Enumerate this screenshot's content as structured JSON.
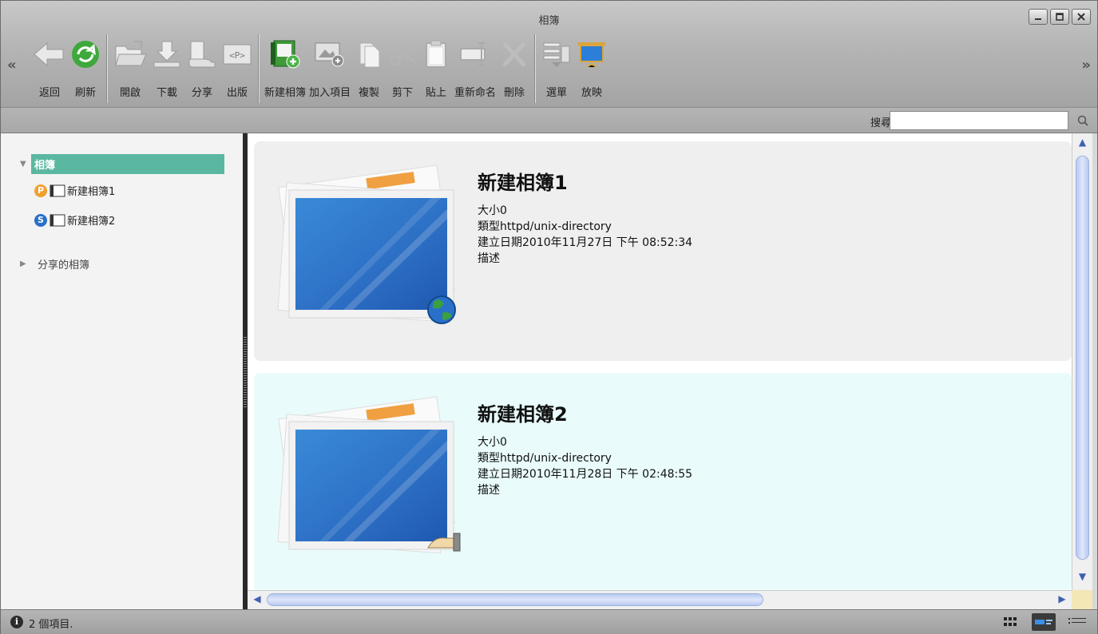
{
  "window": {
    "title": "相簿"
  },
  "toolbar": {
    "items": [
      {
        "label": "返回",
        "icon": "back-arrow-icon"
      },
      {
        "label": "刷新",
        "icon": "refresh-icon"
      },
      {
        "label": "開啟",
        "icon": "open-folder-icon"
      },
      {
        "label": "下載",
        "icon": "download-icon"
      },
      {
        "label": "分享",
        "icon": "share-hand-icon"
      },
      {
        "label": "出版",
        "icon": "publish-p-icon"
      },
      {
        "label": "新建相簿",
        "icon": "new-album-icon"
      },
      {
        "label": "加入項目",
        "icon": "add-item-icon"
      },
      {
        "label": "複製",
        "icon": "copy-icon"
      },
      {
        "label": "剪下",
        "icon": "cut-icon"
      },
      {
        "label": "貼上",
        "icon": "paste-icon"
      },
      {
        "label": "重新命名",
        "icon": "rename-icon"
      },
      {
        "label": "刪除",
        "icon": "delete-icon"
      },
      {
        "label": "選單",
        "icon": "menu-icon"
      },
      {
        "label": "放映",
        "icon": "slideshow-icon"
      }
    ],
    "scroll_left": "«",
    "scroll_right": "»"
  },
  "search": {
    "label": "搜尋",
    "value": "",
    "placeholder": ""
  },
  "sidebar": {
    "root_albums": "相簿",
    "albums": [
      {
        "badge": "P",
        "badge_color": "#f0a030",
        "label": "新建相簿1"
      },
      {
        "badge": "S",
        "badge_color": "#2a70c8",
        "label": "新建相簿2"
      }
    ],
    "root_shared": "分享的相簿"
  },
  "albums": [
    {
      "name": "新建相簿1",
      "size": "大小0",
      "type": "類型httpd/unix-directory",
      "created": "建立日期2010年11月27日 下午 08:52:34",
      "description": "描述",
      "overlay": "globe-icon"
    },
    {
      "name": "新建相簿2",
      "size": "大小0",
      "type": "類型httpd/unix-directory",
      "created": "建立日期2010年11月28日 下午 02:48:55",
      "description": "描述",
      "overlay": "share-hand-icon"
    }
  ],
  "status": {
    "text": "2 個項目.",
    "icon": "info-icon",
    "icon_glyph": "i"
  },
  "colors": {
    "selection": "#5bb8a0",
    "card1_bg": "#efefef",
    "card2_bg": "#e9fbfb",
    "scroll_thumb": "#c8d6f5"
  }
}
